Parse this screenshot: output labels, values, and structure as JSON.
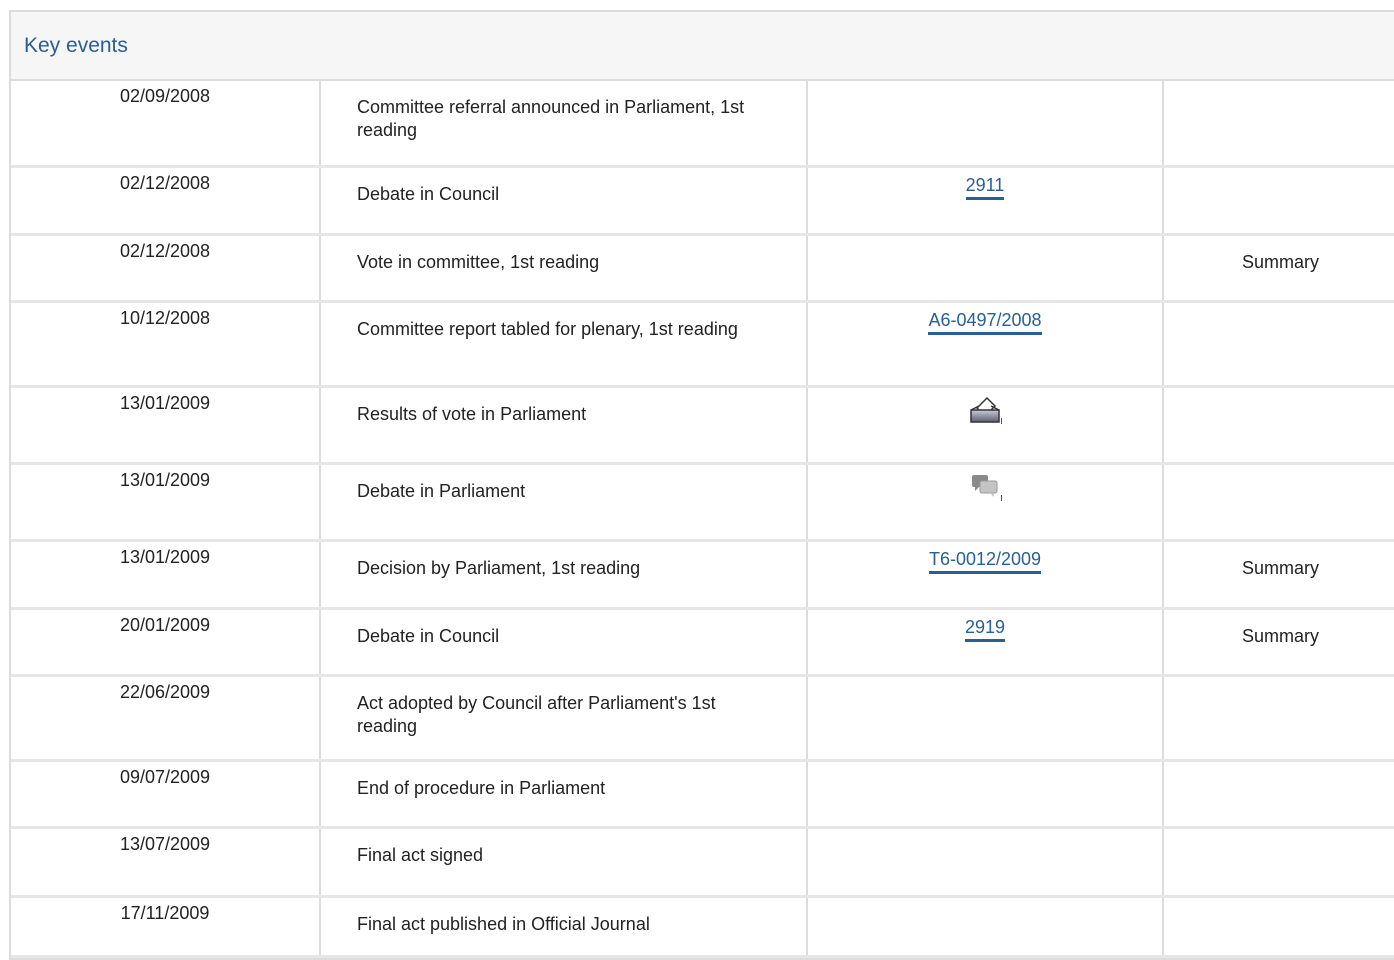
{
  "section": {
    "title": "Key events"
  },
  "events": [
    {
      "date": "02/09/2008",
      "event": "Committee referral announced in Parliament, 1st reading",
      "doc": "",
      "doc_type": "none",
      "summary": ""
    },
    {
      "date": "02/12/2008",
      "event": "Debate in Council",
      "doc": "2911",
      "doc_type": "link",
      "summary": ""
    },
    {
      "date": "02/12/2008",
      "event": "Vote in committee, 1st reading",
      "doc": "",
      "doc_type": "none",
      "summary": "Summary"
    },
    {
      "date": "10/12/2008",
      "event": "Committee report tabled for plenary, 1st reading",
      "doc": "A6-0497/2008",
      "doc_type": "link",
      "summary": ""
    },
    {
      "date": "13/01/2009",
      "event": "Results of vote in Parliament",
      "doc": "",
      "doc_type": "vote-icon",
      "summary": ""
    },
    {
      "date": "13/01/2009",
      "event": "Debate in Parliament",
      "doc": "",
      "doc_type": "debate-icon",
      "summary": ""
    },
    {
      "date": "13/01/2009",
      "event": "Decision by Parliament, 1st reading",
      "doc": "T6-0012/2009",
      "doc_type": "link",
      "summary": "Summary"
    },
    {
      "date": "20/01/2009",
      "event": "Debate in Council",
      "doc": "2919",
      "doc_type": "link",
      "summary": "Summary"
    },
    {
      "date": "22/06/2009",
      "event": "Act adopted by Council after Parliament's 1st reading",
      "doc": "",
      "doc_type": "none",
      "summary": ""
    },
    {
      "date": "09/07/2009",
      "event": "End of procedure in Parliament",
      "doc": "",
      "doc_type": "none",
      "summary": ""
    },
    {
      "date": "13/07/2009",
      "event": "Final act signed",
      "doc": "",
      "doc_type": "none",
      "summary": ""
    },
    {
      "date": "17/11/2009",
      "event": "Final act published in Official Journal",
      "doc": "",
      "doc_type": "none",
      "summary": ""
    }
  ],
  "colors": {
    "title": "#2a5f93",
    "link": "#2a5f93",
    "border": "#dcdcdc",
    "header_bg": "#f6f6f6"
  }
}
